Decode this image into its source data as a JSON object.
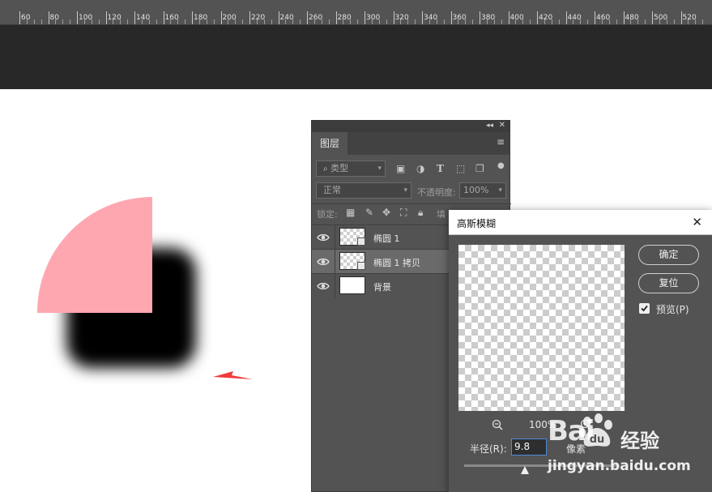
{
  "ruler": {
    "ticks": [
      "60",
      "80",
      "100",
      "120",
      "140",
      "160",
      "180",
      "200",
      "220",
      "240",
      "260",
      "280",
      "300",
      "320",
      "340",
      "360",
      "380",
      "400",
      "420",
      "440",
      "460",
      "480",
      "500",
      "520"
    ]
  },
  "colors": {
    "pink_shape": "#ffa7b1",
    "annotation_arrow": "#ee3b3b",
    "ps_panel": "#535353"
  },
  "layers_panel": {
    "tab": "图层",
    "filter_kind": "类型",
    "blend_mode": "正常",
    "opacity_label": "不透明度:",
    "opacity_value": "100%",
    "lock_label": "锁定:",
    "fill_label": "填",
    "layers": [
      {
        "name": "椭圆 1",
        "thumb": "transparent",
        "selected": false
      },
      {
        "name": "椭圆 1 拷贝",
        "thumb": "transparent",
        "selected": true
      },
      {
        "name": "背景",
        "thumb": "white",
        "selected": false
      }
    ]
  },
  "blur_dialog": {
    "title": "高斯模糊",
    "ok": "确定",
    "reset": "复位",
    "preview_label": "预览(P)",
    "preview_checked": true,
    "zoom": "100%",
    "radius_label": "半径(R):",
    "radius_value": "9.8",
    "unit": "像素"
  },
  "watermark": {
    "logo": "Bai",
    "logo_cn": "经验",
    "url": "jingyan.baidu.com"
  }
}
